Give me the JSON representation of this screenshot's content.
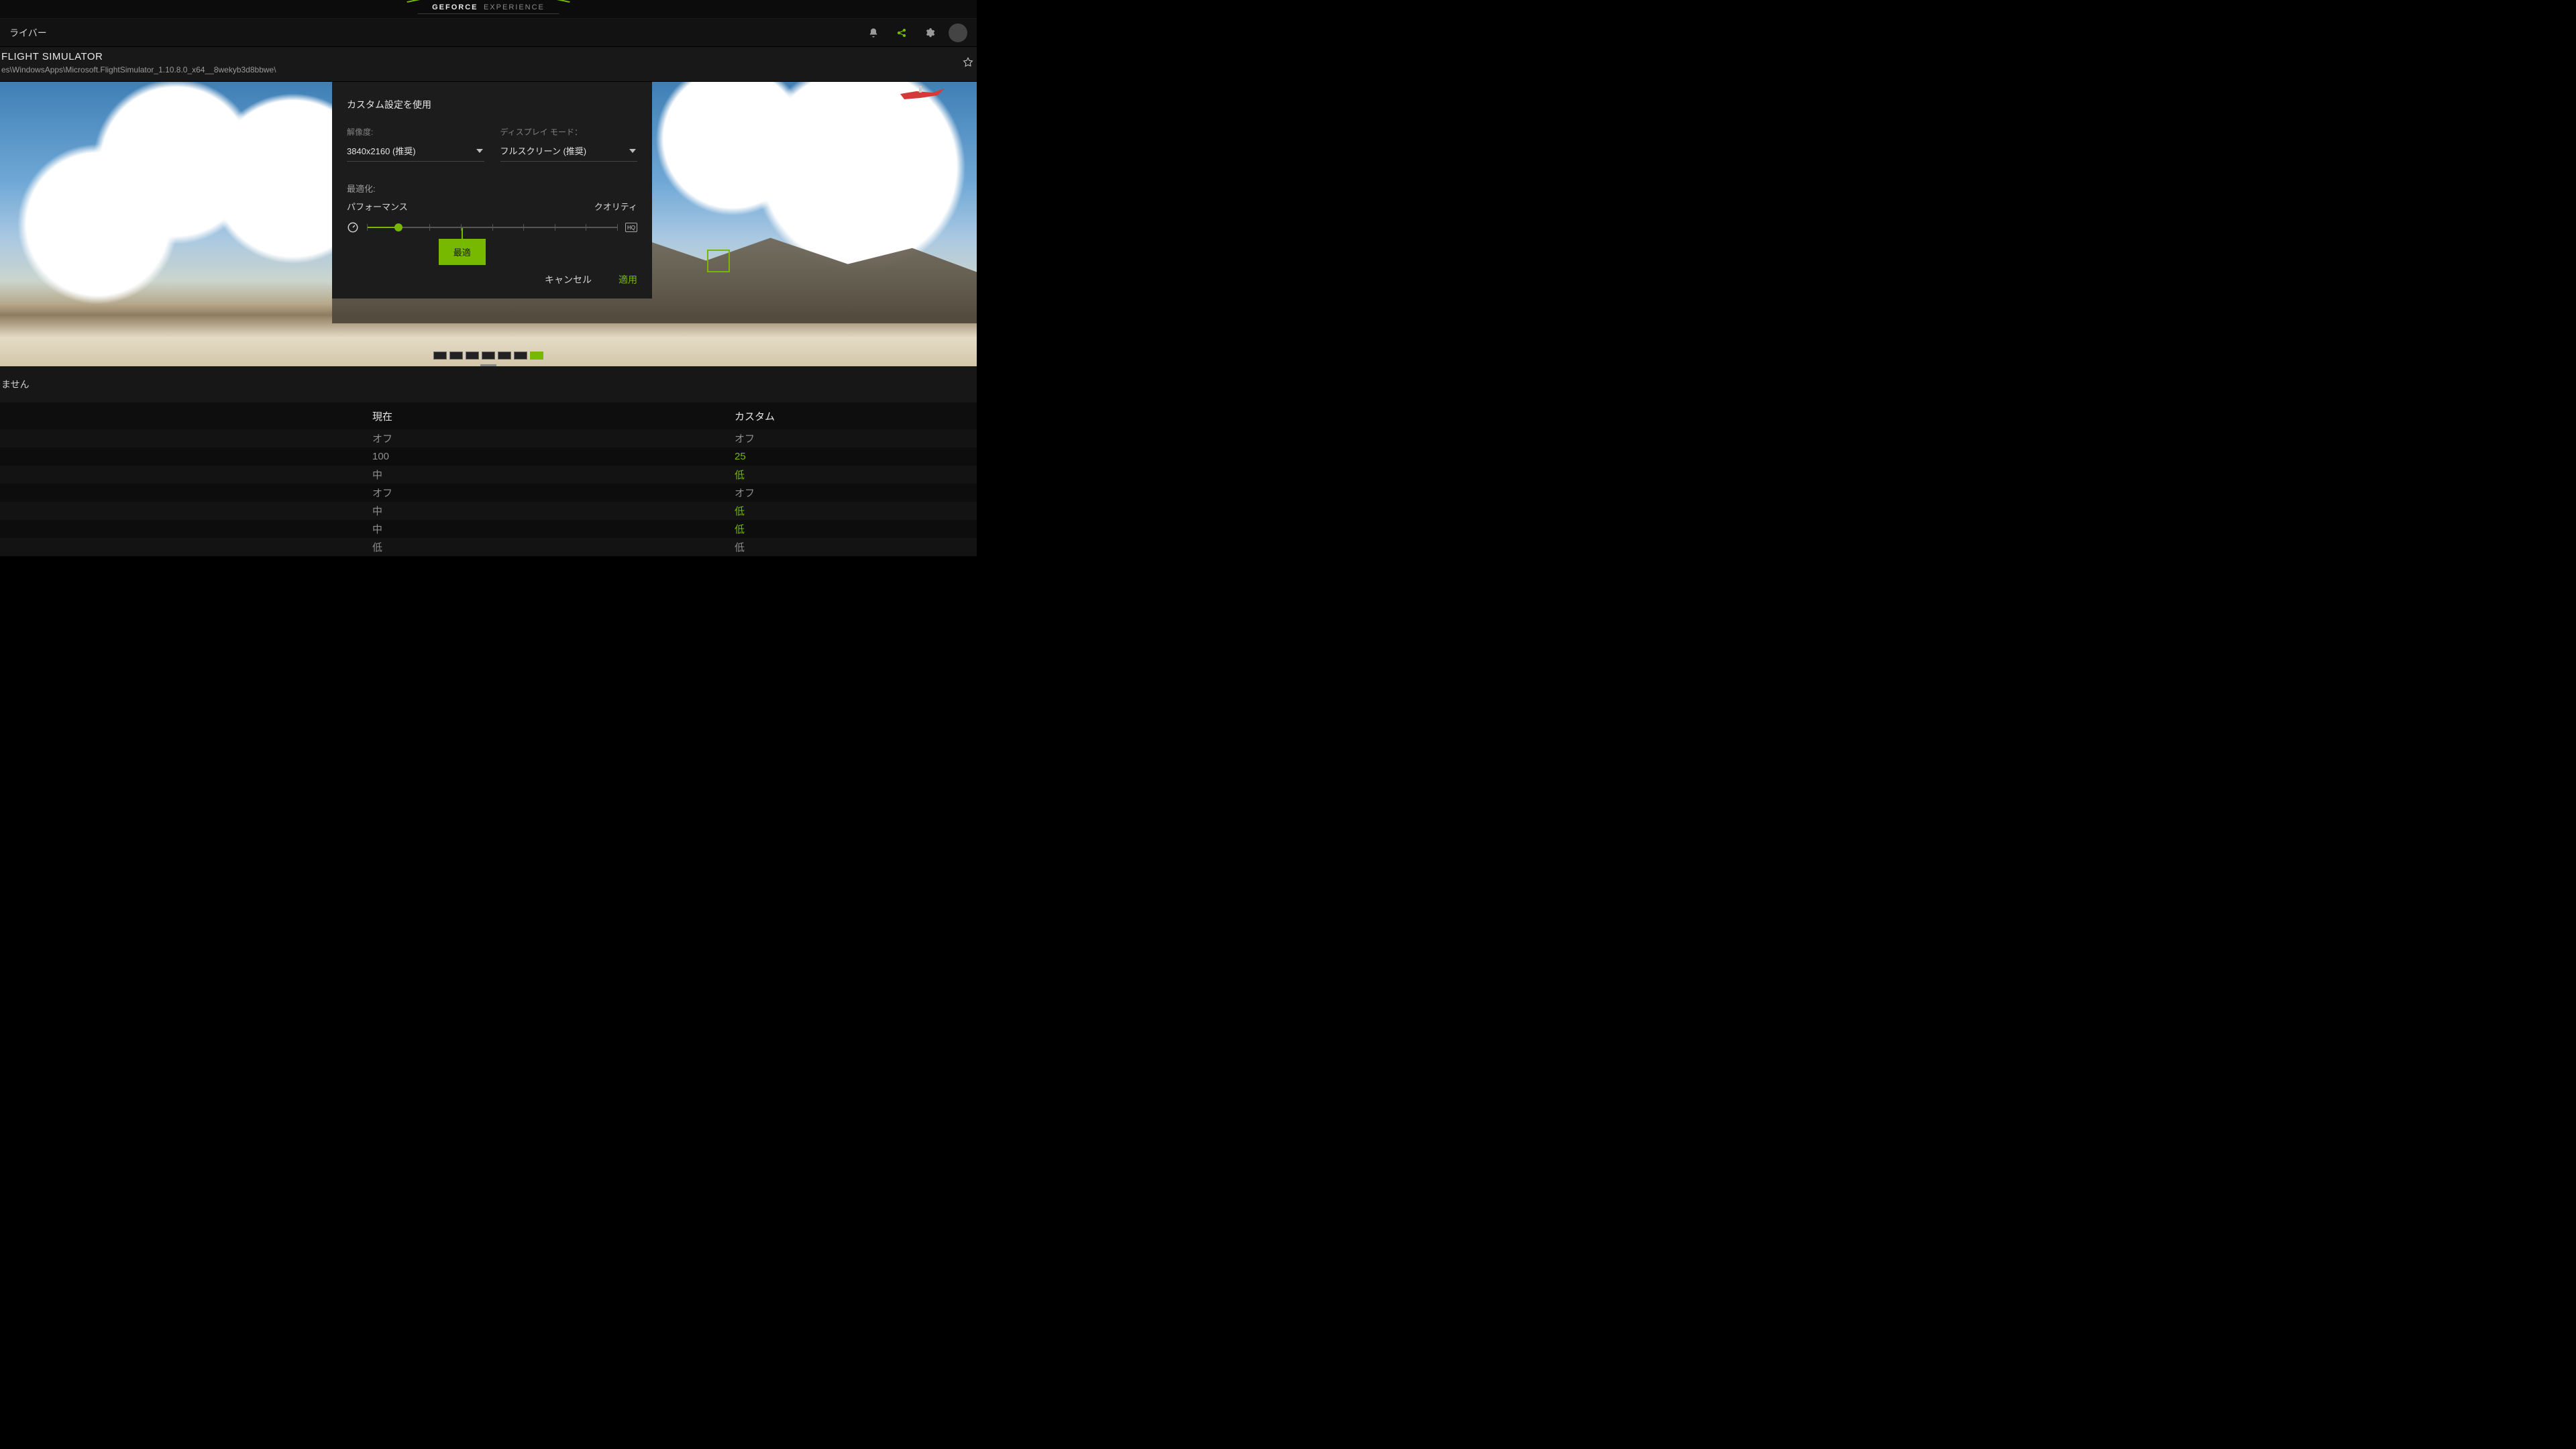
{
  "brand": {
    "strong": "GEFORCE",
    "light": "EXPERIENCE"
  },
  "menubar": {
    "driver_tab": "ライバー"
  },
  "game": {
    "title": "FLIGHT SIMULATOR",
    "path": "es\\WindowsApps\\Microsoft.FlightSimulator_1.10.8.0_x64__8wekyb3d8bbwe\\"
  },
  "modal": {
    "title": "カスタム設定を使用",
    "resolution_label": "解像度:",
    "resolution_value": "3840x2160 (推奨)",
    "display_label": "ディスプレイ モード：",
    "display_value": "フルスクリーン (推奨)",
    "optimize_label": "最適化:",
    "slider_left": "パフォーマンス",
    "slider_right": "クオリティ",
    "optimal_tag": "最適",
    "hq_badge": "HQ",
    "cancel": "キャンセル",
    "apply": "適用"
  },
  "status": {
    "text": "ません"
  },
  "table": {
    "col_current": "現在",
    "col_custom": "カスタム",
    "rows": [
      {
        "current": "オフ",
        "custom": "オフ",
        "diff": false
      },
      {
        "current": "100",
        "custom": "25",
        "diff": true
      },
      {
        "current": "中",
        "custom": "低",
        "diff": true
      },
      {
        "current": "オフ",
        "custom": "オフ",
        "diff": false
      },
      {
        "current": "中",
        "custom": "低",
        "diff": true
      },
      {
        "current": "中",
        "custom": "低",
        "diff": true
      },
      {
        "current": "低",
        "custom": "低",
        "diff": false
      }
    ]
  }
}
